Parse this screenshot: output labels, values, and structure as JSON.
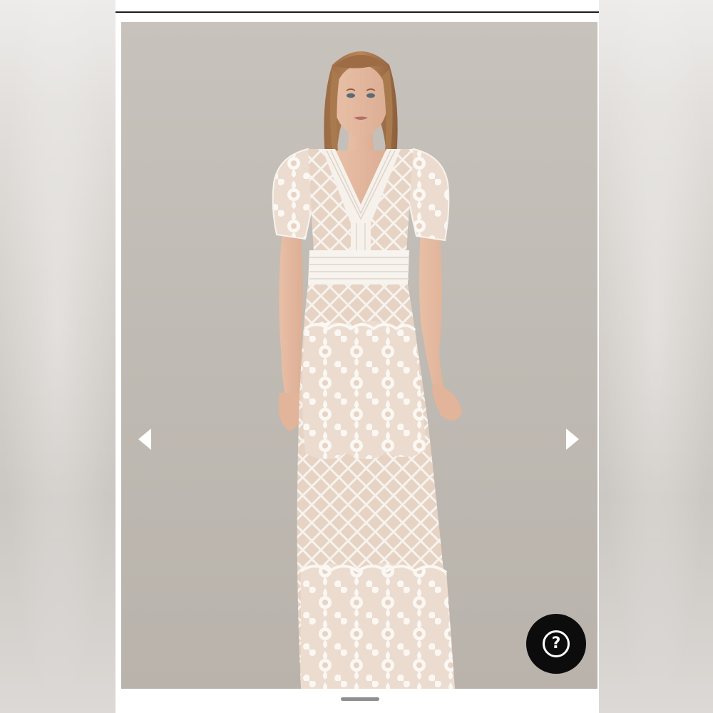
{
  "viewer": {
    "image_subject": "model-in-white-lace-maxi-dress",
    "prev_icon": "chevron-left-icon",
    "next_icon": "chevron-right-icon"
  },
  "help": {
    "glyph": "?",
    "icon": "question-circle-icon"
  },
  "colors": {
    "background_photo": "#c2bdb6",
    "help_button": "#0c0c0c",
    "arrow": "#ffffff"
  }
}
